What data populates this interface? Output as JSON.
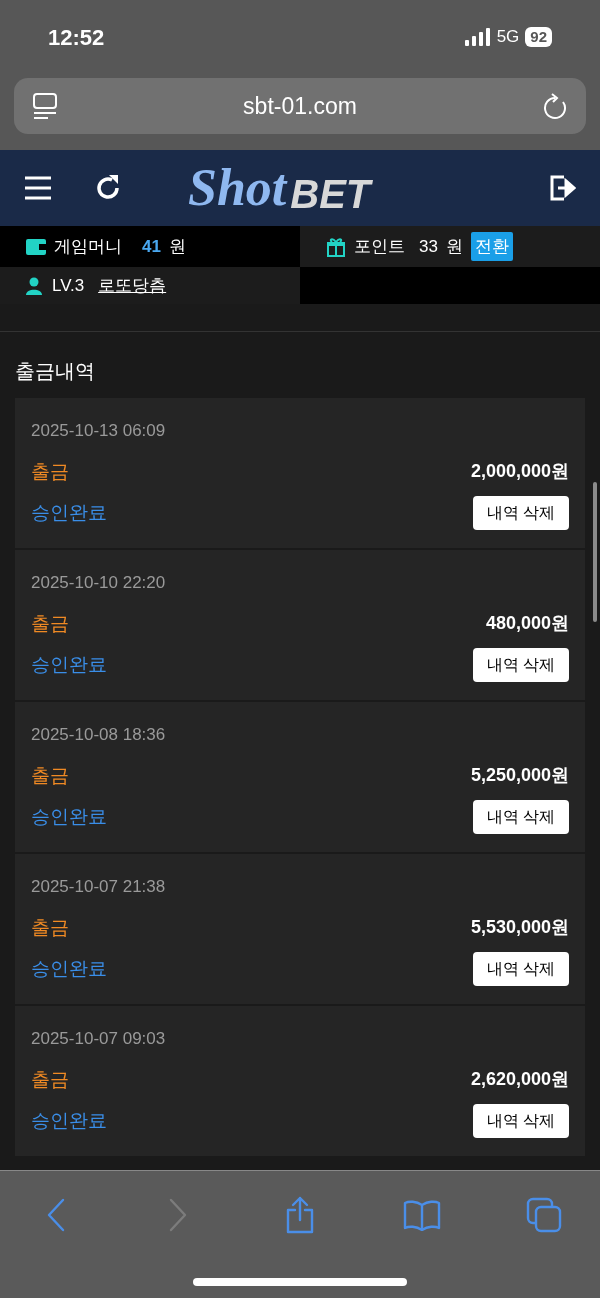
{
  "status_bar": {
    "time": "12:52",
    "network": "5G",
    "battery": "92"
  },
  "address_bar": {
    "url": "sbt-01.com"
  },
  "header": {
    "logo_script": "Shot",
    "logo_word": "BET"
  },
  "wallet": {
    "label": "게임머니",
    "amount": "41",
    "unit": "원"
  },
  "points": {
    "label": "포인트",
    "amount": "33",
    "unit": "원",
    "button": "전환"
  },
  "user": {
    "level": "LV.3",
    "name": "로또당츰"
  },
  "section_title": "출금내역",
  "records": [
    {
      "date": "2025-10-13 06:09",
      "type": "출금",
      "amount": "2,000,000원",
      "status": "승인완료",
      "button": "내역 삭제"
    },
    {
      "date": "2025-10-10 22:20",
      "type": "출금",
      "amount": "480,000원",
      "status": "승인완료",
      "button": "내역 삭제"
    },
    {
      "date": "2025-10-08 18:36",
      "type": "출금",
      "amount": "5,250,000원",
      "status": "승인완료",
      "button": "내역 삭제"
    },
    {
      "date": "2025-10-07 21:38",
      "type": "출금",
      "amount": "5,530,000원",
      "status": "승인완료",
      "button": "내역 삭제"
    },
    {
      "date": "2025-10-07 09:03",
      "type": "출금",
      "amount": "2,620,000원",
      "status": "승인완료",
      "button": "내역 삭제"
    }
  ],
  "toolbar": [
    {
      "kind": "back",
      "disabled": false
    },
    {
      "kind": "forward",
      "disabled": true
    },
    {
      "kind": "share",
      "disabled": false
    },
    {
      "kind": "bookmarks",
      "disabled": false
    },
    {
      "kind": "tabs",
      "disabled": false
    }
  ]
}
